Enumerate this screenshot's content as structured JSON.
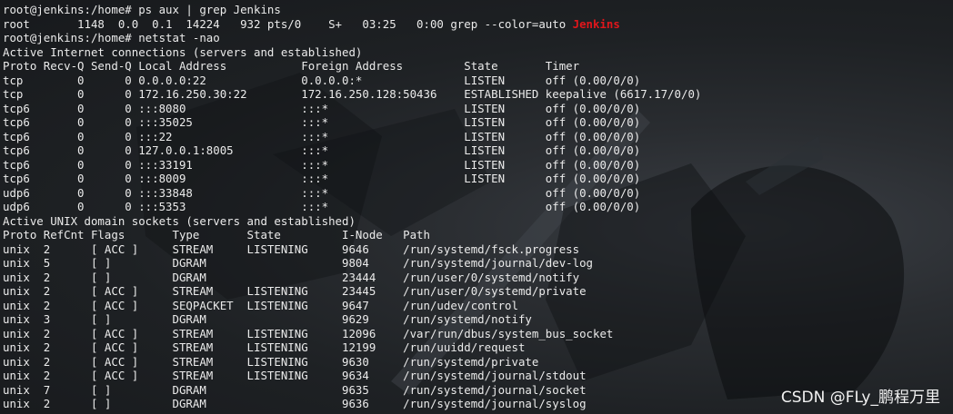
{
  "terminal": {
    "lines": [
      "root@jenkins:/home# ps aux | grep Jenkins",
      "root       1148  0.0  0.1  14224   932 pts/0    S+   03:25   0:00 grep --color=auto ",
      "root@jenkins:/home# netstat -nao",
      "Active Internet connections (servers and established)",
      "Proto Recv-Q Send-Q Local Address           Foreign Address         State       Timer",
      "tcp        0      0 0.0.0.0:22              0.0.0.0:*               LISTEN      off (0.00/0/0)",
      "tcp        0      0 172.16.250.30:22        172.16.250.128:50436    ESTABLISHED keepalive (6617.17/0/0)",
      "tcp6       0      0 :::8080                 :::*                    LISTEN      off (0.00/0/0)",
      "tcp6       0      0 :::35025                :::*                    LISTEN      off (0.00/0/0)",
      "tcp6       0      0 :::22                   :::*                    LISTEN      off (0.00/0/0)",
      "tcp6       0      0 127.0.0.1:8005          :::*                    LISTEN      off (0.00/0/0)",
      "tcp6       0      0 :::33191                :::*                    LISTEN      off (0.00/0/0)",
      "tcp6       0      0 :::8009                 :::*                    LISTEN      off (0.00/0/0)",
      "udp6       0      0 :::33848                :::*                                off (0.00/0/0)",
      "udp6       0      0 :::5353                 :::*                                off (0.00/0/0)",
      "Active UNIX domain sockets (servers and established)",
      "Proto RefCnt Flags       Type       State         I-Node   Path",
      "unix  2      [ ACC ]     STREAM     LISTENING     9646     /run/systemd/fsck.progress",
      "unix  5      [ ]         DGRAM                    9804     /run/systemd/journal/dev-log",
      "unix  2      [ ]         DGRAM                    23444    /run/user/0/systemd/notify",
      "unix  2      [ ACC ]     STREAM     LISTENING     23445    /run/user/0/systemd/private",
      "unix  2      [ ACC ]     SEQPACKET  LISTENING     9647     /run/udev/control",
      "unix  3      [ ]         DGRAM                    9629     /run/systemd/notify",
      "unix  2      [ ACC ]     STREAM     LISTENING     12096    /var/run/dbus/system_bus_socket",
      "unix  2      [ ACC ]     STREAM     LISTENING     12199    /run/uuidd/request",
      "unix  2      [ ACC ]     STREAM     LISTENING     9630     /run/systemd/private",
      "unix  2      [ ACC ]     STREAM     LISTENING     9634     /run/systemd/journal/stdout",
      "unix  7      [ ]         DGRAM                    9635     /run/systemd/journal/socket",
      "unix  2      [ ]         DGRAM                    9636     /run/systemd/journal/syslog"
    ],
    "highlight": {
      "line": 1,
      "text": "Jenkins",
      "color": "#e0161b"
    }
  },
  "watermark": "CSDN @FLy_鹏程万里",
  "colors": {
    "background": "#1d2024",
    "text": "#ebebeb"
  }
}
